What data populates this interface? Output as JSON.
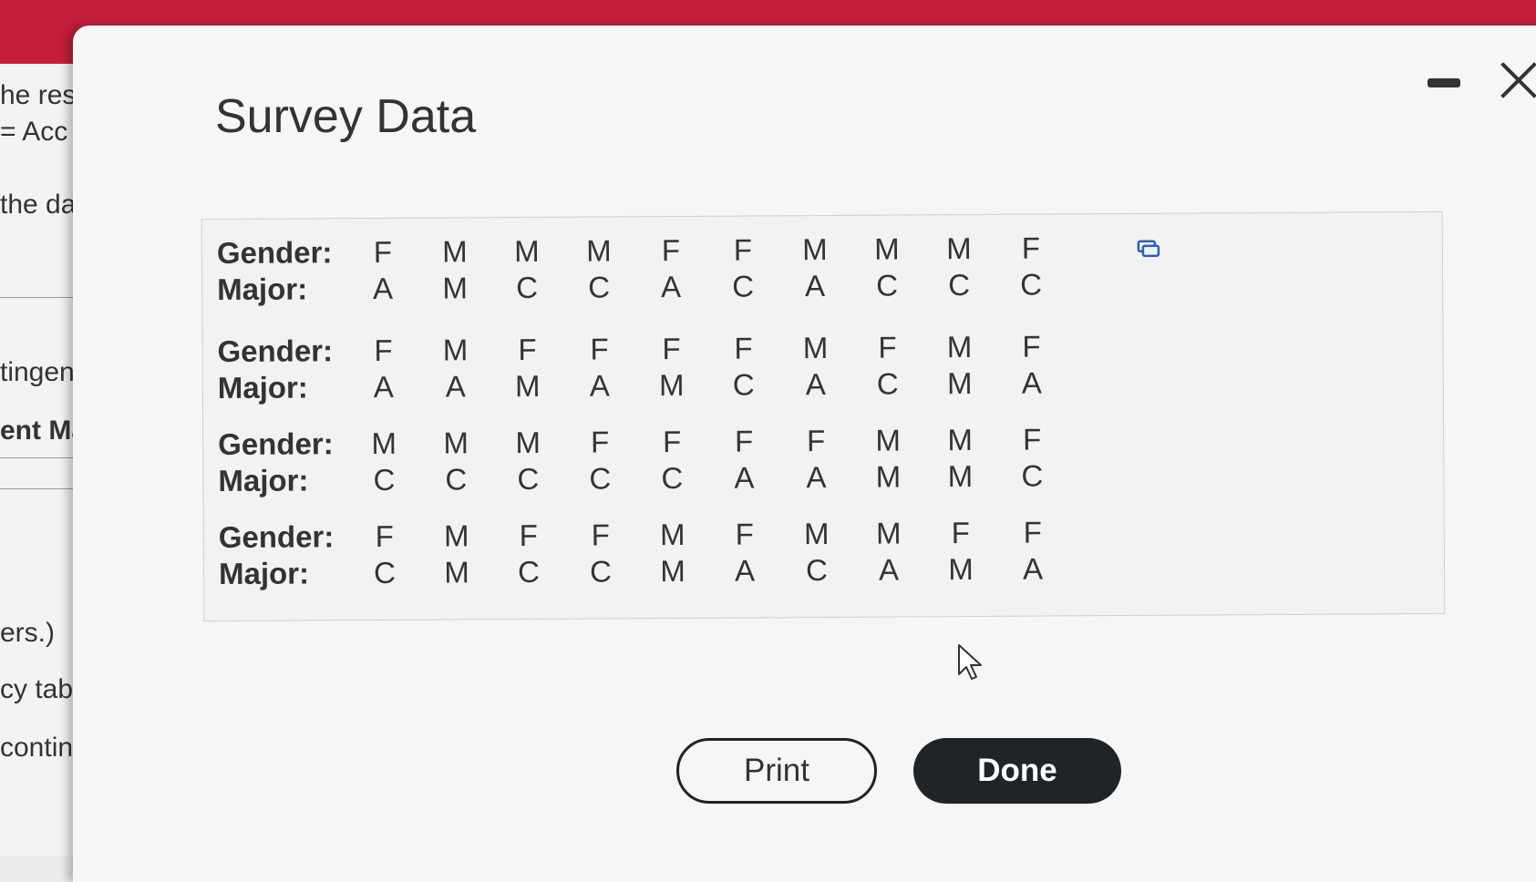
{
  "background": {
    "lines": [
      "he res",
      "= Acc",
      "the dat",
      "tingenc",
      "ent Maj",
      "ers.)",
      "cy tables b",
      "contingen"
    ]
  },
  "dialog": {
    "title": "Survey Data",
    "rows": [
      {
        "gender_label": "Gender:",
        "major_label": "Major:",
        "gender": [
          "F",
          "M",
          "M",
          "M",
          "F",
          "F",
          "M",
          "M",
          "M",
          "F"
        ],
        "major": [
          "A",
          "M",
          "C",
          "C",
          "A",
          "C",
          "A",
          "C",
          "C",
          "C"
        ]
      },
      {
        "gender_label": "Gender:",
        "major_label": "Major:",
        "gender": [
          "F",
          "M",
          "F",
          "F",
          "F",
          "F",
          "M",
          "F",
          "M",
          "F"
        ],
        "major": [
          "A",
          "A",
          "M",
          "A",
          "M",
          "C",
          "A",
          "C",
          "M",
          "A"
        ]
      },
      {
        "gender_label": "Gender:",
        "major_label": "Major:",
        "gender": [
          "M",
          "M",
          "M",
          "F",
          "F",
          "F",
          "F",
          "M",
          "M",
          "F"
        ],
        "major": [
          "C",
          "C",
          "C",
          "C",
          "C",
          "A",
          "A",
          "M",
          "M",
          "C"
        ]
      },
      {
        "gender_label": "Gender:",
        "major_label": "Major:",
        "gender": [
          "F",
          "M",
          "F",
          "F",
          "M",
          "F",
          "M",
          "M",
          "F",
          "F"
        ],
        "major": [
          "C",
          "M",
          "C",
          "C",
          "M",
          "A",
          "C",
          "A",
          "M",
          "A"
        ]
      }
    ],
    "buttons": {
      "print": "Print",
      "done": "Done"
    }
  },
  "colors": {
    "accent_red": "#c41e3a",
    "done_bg": "#1f2428"
  }
}
